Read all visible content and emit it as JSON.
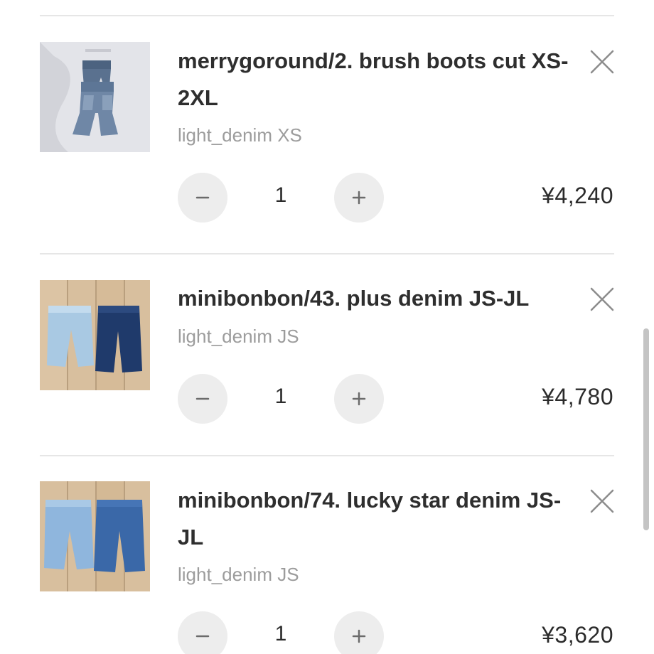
{
  "cart": {
    "items": [
      {
        "title": "merrygoround/2. brush boots cut XS-2XL",
        "variant": "light_denim XS",
        "quantity": "1",
        "price": "¥4,240",
        "thumbnail_icon": "boot-cut-jeans-photo"
      },
      {
        "title": "minibonbon/43. plus denim JS-JL",
        "variant": "light_denim JS",
        "quantity": "1",
        "price": "¥4,780",
        "thumbnail_icon": "two-denim-pants-photo"
      },
      {
        "title": "minibonbon/74. lucky star denim JS-JL",
        "variant": "light_denim JS",
        "quantity": "1",
        "price": "¥3,620",
        "thumbnail_icon": "two-denim-pants-photo"
      }
    ],
    "remove_icon": "close-icon",
    "decrease_icon": "minus-icon",
    "increase_icon": "plus-icon"
  },
  "colors": {
    "divider": "#e6e6e6",
    "qty_button_bg": "#ededed",
    "variant_text": "#9c9c9c",
    "title_text": "#2e2e2e"
  }
}
